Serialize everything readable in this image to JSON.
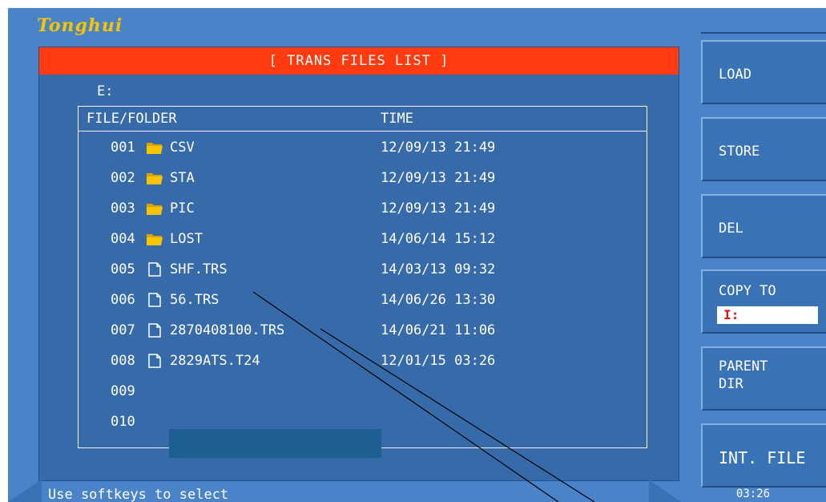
{
  "brand": "Tonghui",
  "window_title": "[ TRANS FILES LIST ]",
  "path": "E:",
  "columns": {
    "file": "FILE/FOLDER",
    "time": "TIME"
  },
  "rows": [
    {
      "index": "001",
      "icon": "folder-icon",
      "name": "CSV",
      "time": "12/09/13 21:49"
    },
    {
      "index": "002",
      "icon": "folder-icon",
      "name": "STA",
      "time": "12/09/13 21:49"
    },
    {
      "index": "003",
      "icon": "folder-icon",
      "name": "PIC",
      "time": "12/09/13 21:49"
    },
    {
      "index": "004",
      "icon": "folder-icon",
      "name": "LOST",
      "time": "14/06/14 15:12"
    },
    {
      "index": "005",
      "icon": "file-icon",
      "name": "SHF.TRS",
      "time": "14/03/13 09:32"
    },
    {
      "index": "006",
      "icon": "file-icon",
      "name": "56.TRS",
      "time": "14/06/26 13:30"
    },
    {
      "index": "007",
      "icon": "file-icon",
      "name": "2870408100.TRS",
      "time": "14/06/21 11:06"
    },
    {
      "index": "008",
      "icon": "file-icon",
      "name": "2829ATS.T24",
      "time": "12/01/15 03:26"
    },
    {
      "index": "009",
      "icon": "",
      "name": "",
      "time": ""
    },
    {
      "index": "010",
      "icon": "",
      "name": "",
      "time": ""
    }
  ],
  "status_text": "Use softkeys to select",
  "softkeys": {
    "load": "LOAD",
    "store": "STORE",
    "del": "DEL",
    "copy_to": "COPY TO",
    "copy_target": "I:",
    "parent_dir": "PARENT\nDIR",
    "int_file": "INT. FILE"
  },
  "clock": "03:26",
  "colors": {
    "background": "#4b83c9",
    "panel": "#366aa9",
    "title_bar": "#ff3b0f",
    "brand": "#f6c500",
    "folder": "#f6c500"
  }
}
